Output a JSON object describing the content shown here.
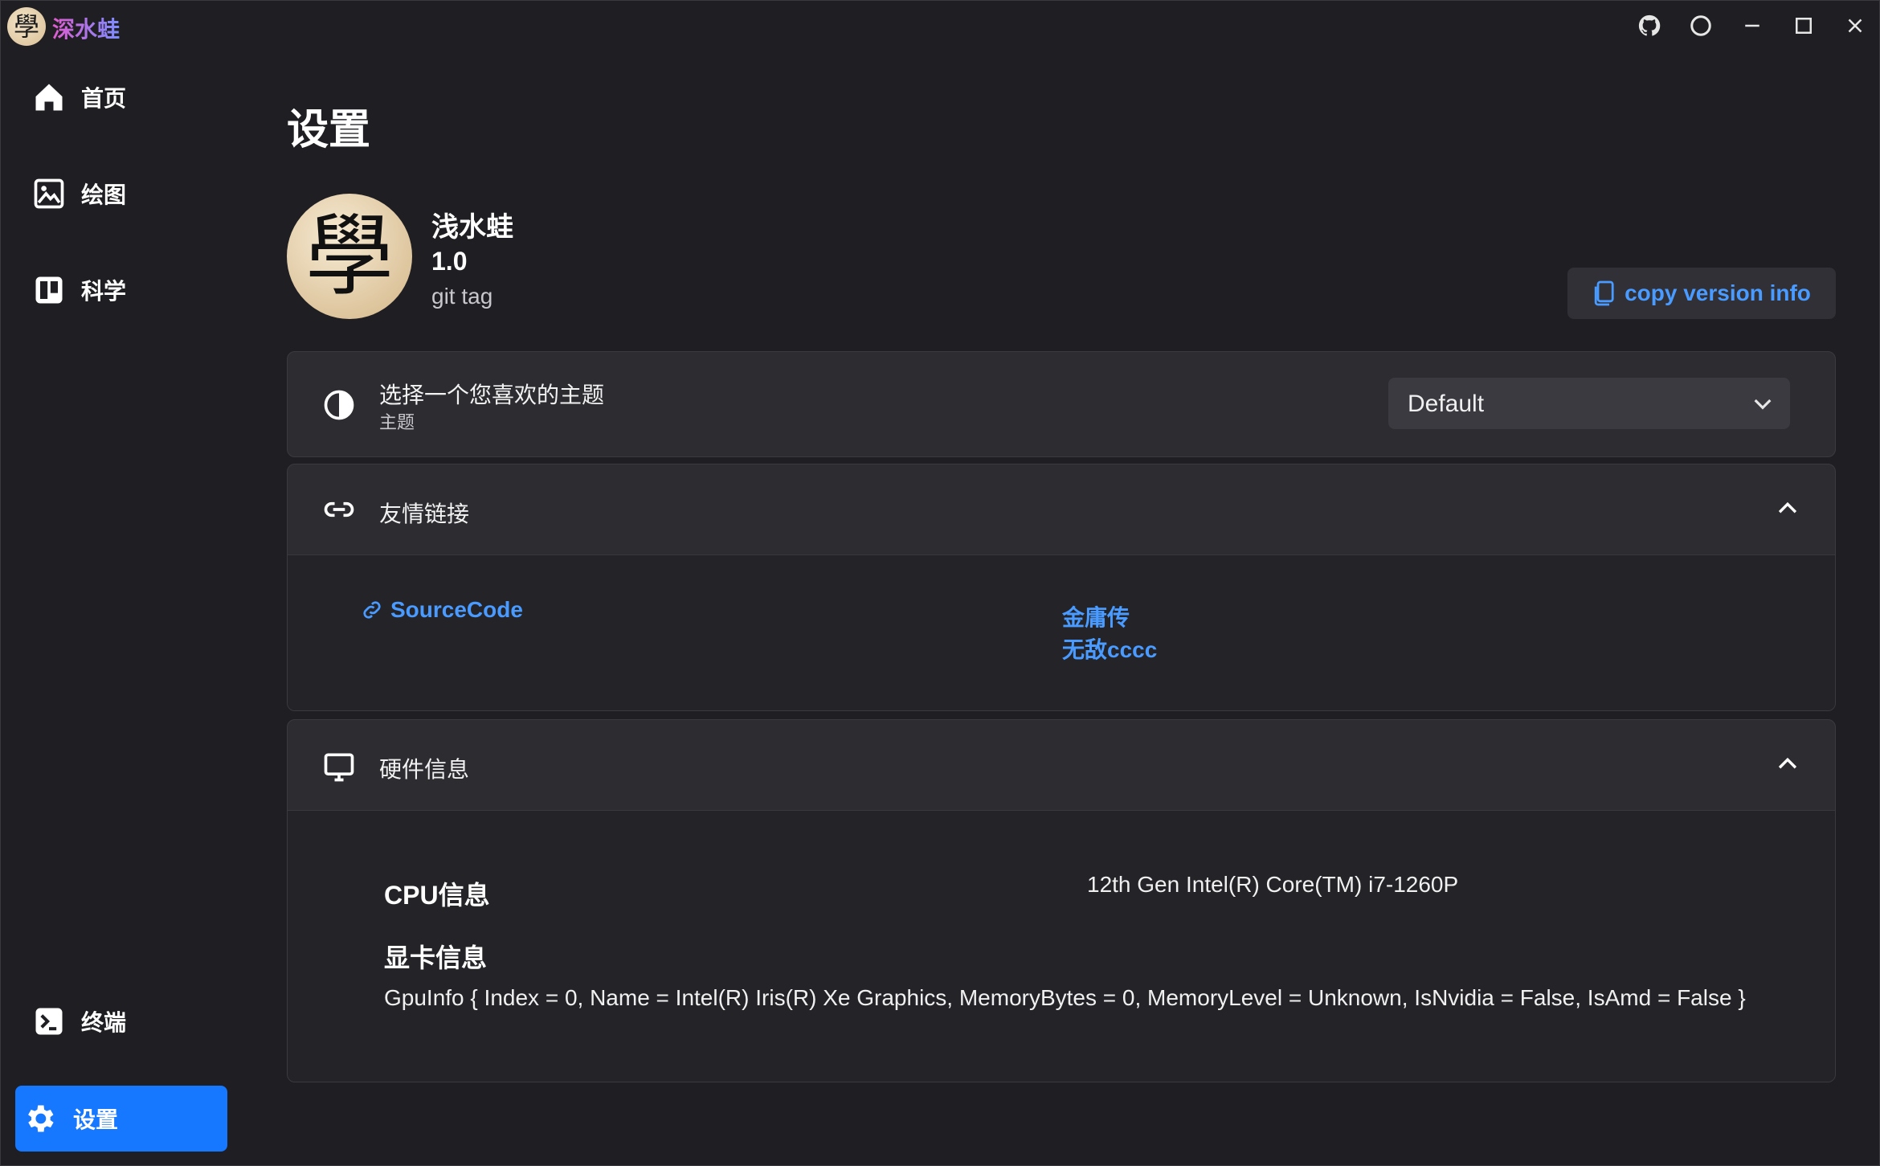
{
  "app": {
    "title": "深水蛙",
    "logo_glyph": "學"
  },
  "window_controls": [
    "github-icon",
    "theme-toggle-icon",
    "minimize-icon",
    "maximize-icon",
    "close-icon"
  ],
  "sidebar": {
    "items": [
      {
        "label": "首页",
        "icon": "home-icon"
      },
      {
        "label": "绘图",
        "icon": "image-icon"
      },
      {
        "label": "科学",
        "icon": "board-icon"
      }
    ],
    "bottom_items": [
      {
        "label": "终端",
        "icon": "terminal-icon"
      },
      {
        "label": "设置",
        "icon": "gear-icon",
        "active": true
      }
    ]
  },
  "page": {
    "title": "设置"
  },
  "about": {
    "avatar_glyph": "學",
    "name": "浅水蛙",
    "version": "1.0",
    "tag": "git tag",
    "copy_button": "copy version info"
  },
  "theme_card": {
    "title": "选择一个您喜欢的主题",
    "subtitle": "主题",
    "selected": "Default"
  },
  "links_card": {
    "title": "友情链接",
    "source_code": "SourceCode",
    "links": [
      "金庸传",
      "无敌cccc"
    ]
  },
  "hardware_card": {
    "title": "硬件信息",
    "cpu_label": "CPU信息",
    "cpu_value": "12th Gen Intel(R) Core(TM) i7-1260P",
    "gpu_label": "显卡信息",
    "gpu_value": "GpuInfo { Index = 0, Name = Intel(R) Iris(R) Xe Graphics, MemoryBytes = 0, MemoryLevel = Unknown, IsNvidia = False, IsAmd = False }"
  },
  "colors": {
    "accent": "#1677ff",
    "link": "#4a9bff",
    "background": "#1f1f23",
    "card": "#2c2c31"
  }
}
